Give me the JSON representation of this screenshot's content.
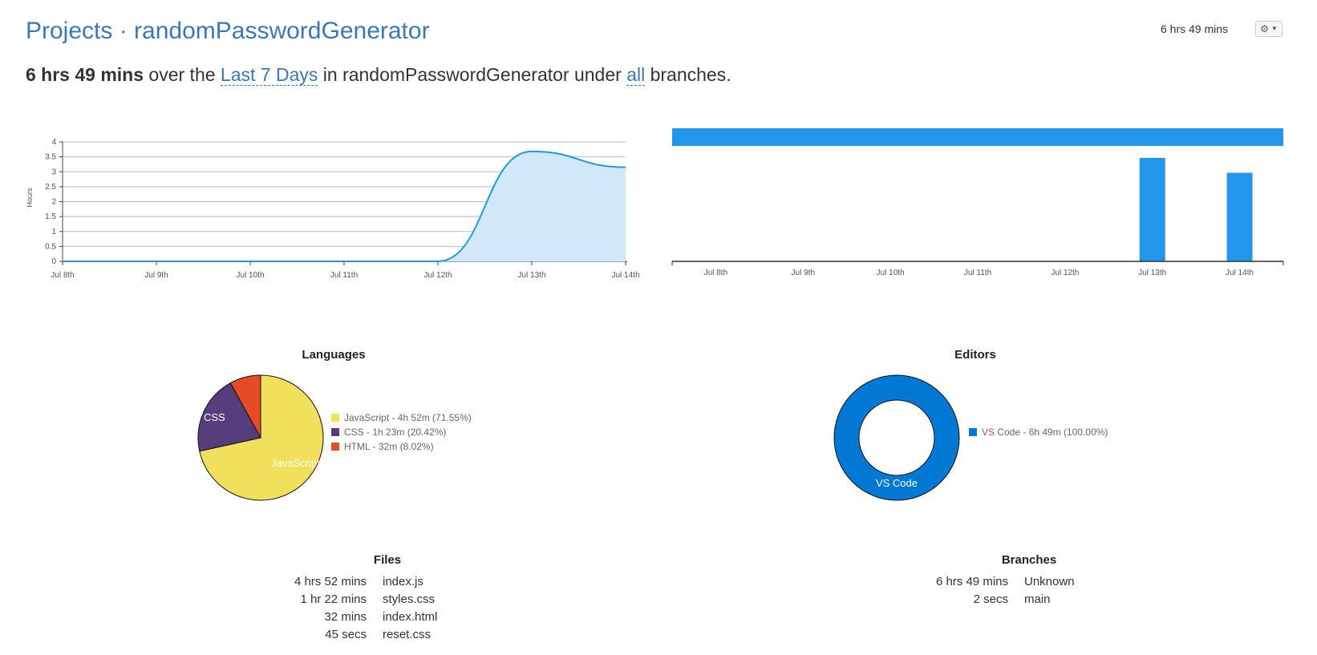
{
  "header": {
    "breadcrumb_projects": "Projects",
    "separator": " · ",
    "project_name": "randomPasswordGenerator",
    "total_time": "6 hrs 49 mins"
  },
  "summary": {
    "total": "6 hrs 49 mins",
    "over_the": "over the",
    "range_link": "Last 7 Days",
    "in_text": "in randomPasswordGenerator under",
    "branch_link": "all",
    "end_text": "branches."
  },
  "chart_data": [
    {
      "type": "area",
      "ylabel": "Hours",
      "categories": [
        "Jul 8th",
        "Jul 9th",
        "Jul 10th",
        "Jul 11th",
        "Jul 12th",
        "Jul 13th",
        "Jul 14th"
      ],
      "values": [
        0,
        0,
        0,
        0,
        0,
        3.68,
        3.15
      ],
      "yticks": [
        "0",
        "0.5",
        "1",
        "1.5",
        "2",
        "2.5",
        "3",
        "3.5",
        "4"
      ],
      "ylim": [
        0,
        4
      ],
      "line_color": "#1f99e0",
      "fill_color": "#d2e8f9"
    },
    {
      "type": "bar",
      "categories": [
        "Jul 8th",
        "Jul 9th",
        "Jul 10th",
        "Jul 11th",
        "Jul 12th",
        "Jul 13th",
        "Jul 14th"
      ],
      "values": [
        0,
        0,
        0,
        0,
        0,
        3.68,
        3.15
      ],
      "total_bar_label_color": "#2196eb",
      "bar_color": "#2196eb"
    },
    {
      "type": "pie",
      "title": "Languages",
      "slices": [
        {
          "label": "JavaScript",
          "legend": "JavaScript - 4h 52m (71.55%)",
          "percent": 71.55,
          "color": "#f0e05b"
        },
        {
          "label": "CSS",
          "legend": "CSS - 1h 23m (20.42%)",
          "percent": 20.42,
          "color": "#563d7c"
        },
        {
          "label": "HTML",
          "legend": "HTML - 32m (8.02%)",
          "percent": 8.02,
          "color": "#e34c26"
        }
      ]
    },
    {
      "type": "pie",
      "title": "Editors",
      "slices": [
        {
          "label": "VS Code",
          "legend": "VS Code - 6h 49m (100.00%)",
          "percent": 100.0,
          "color": "#0078d4"
        }
      ]
    }
  ],
  "files": {
    "title": "Files",
    "rows": [
      {
        "duration": "4 hrs 52 mins",
        "name": "index.js"
      },
      {
        "duration": "1 hr 22 mins",
        "name": "styles.css"
      },
      {
        "duration": "32 mins",
        "name": "index.html"
      },
      {
        "duration": "45 secs",
        "name": "reset.css"
      }
    ]
  },
  "branches": {
    "title": "Branches",
    "rows": [
      {
        "duration": "6 hrs 49 mins",
        "name": "Unknown"
      },
      {
        "duration": "2 secs",
        "name": "main"
      }
    ]
  }
}
